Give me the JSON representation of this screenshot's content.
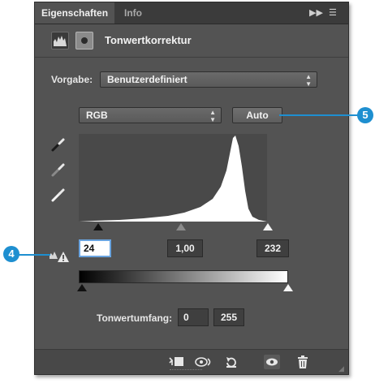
{
  "panel": {
    "tabs": [
      {
        "label": "Eigenschaften"
      },
      {
        "label": "Info"
      }
    ],
    "title": "Tonwertkorrektur",
    "preset_label": "Vorgabe:",
    "preset_value": "Benutzerdefiniert",
    "channel_value": "RGB",
    "auto_label": "Auto",
    "input_black": "24",
    "input_gamma": "1,00",
    "input_white": "232",
    "output_label": "Tonwertumfang:",
    "output_black": "0",
    "output_white": "255"
  },
  "callouts": {
    "c4": "4",
    "c5": "5"
  },
  "colors": {
    "panel_bg": "#535353",
    "callout": "#1e8fd0",
    "histogram": "#ffffff"
  },
  "icons": [
    "panel-expand-icon",
    "panel-menu-icon",
    "levels-icon",
    "mask-icon",
    "black-point-eyedropper-icon",
    "gray-point-eyedropper-icon",
    "white-point-eyedropper-icon",
    "clipping-warning-icon",
    "clip-to-layer-icon",
    "view-previous-state-icon",
    "reset-icon",
    "visibility-eye-icon",
    "trash-icon"
  ]
}
